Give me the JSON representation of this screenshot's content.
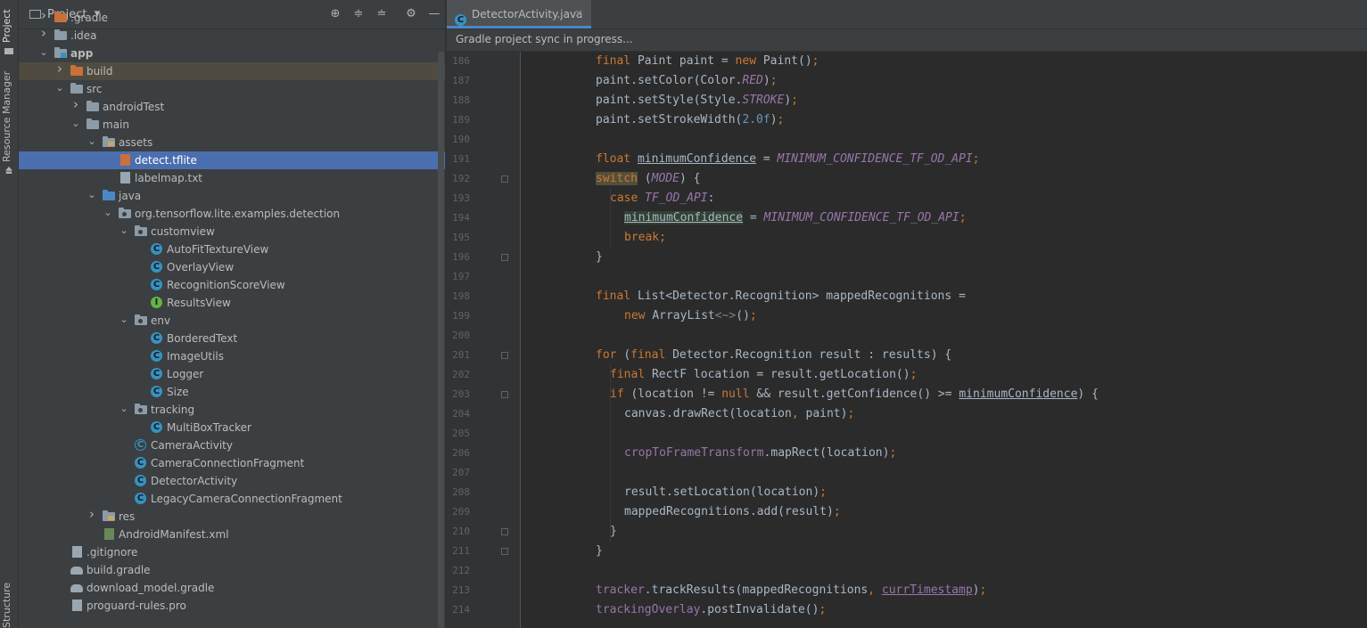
{
  "toolstrip": {
    "tabs": [
      "Project",
      "Resource Manager",
      "Structure"
    ]
  },
  "project_panel": {
    "title": "Project",
    "tree": [
      {
        "label": ".gradle",
        "depth": 1,
        "arrow": "right",
        "icon": "folder-orange"
      },
      {
        "label": ".idea",
        "depth": 1,
        "arrow": "right",
        "icon": "folder"
      },
      {
        "label": "app",
        "depth": 1,
        "arrow": "down",
        "icon": "module-folder",
        "bold": true
      },
      {
        "label": "build",
        "depth": 2,
        "arrow": "right",
        "icon": "folder-orange",
        "excluded": true
      },
      {
        "label": "src",
        "depth": 2,
        "arrow": "down",
        "icon": "folder"
      },
      {
        "label": "androidTest",
        "depth": 3,
        "arrow": "right",
        "icon": "folder"
      },
      {
        "label": "main",
        "depth": 3,
        "arrow": "down",
        "icon": "folder"
      },
      {
        "label": "assets",
        "depth": 4,
        "arrow": "down",
        "icon": "resource-folder"
      },
      {
        "label": "detect.tflite",
        "depth": 5,
        "arrow": "",
        "icon": "tflite-file",
        "selected": true
      },
      {
        "label": "labelmap.txt",
        "depth": 5,
        "arrow": "",
        "icon": "text-file"
      },
      {
        "label": "java",
        "depth": 4,
        "arrow": "down",
        "icon": "source-folder"
      },
      {
        "label": "org.tensorflow.lite.examples.detection",
        "depth": 5,
        "arrow": "down",
        "icon": "package"
      },
      {
        "label": "customview",
        "depth": 6,
        "arrow": "down",
        "icon": "package"
      },
      {
        "label": "AutoFitTextureView",
        "depth": 7,
        "arrow": "",
        "icon": "class"
      },
      {
        "label": "OverlayView",
        "depth": 7,
        "arrow": "",
        "icon": "class"
      },
      {
        "label": "RecognitionScoreView",
        "depth": 7,
        "arrow": "",
        "icon": "class"
      },
      {
        "label": "ResultsView",
        "depth": 7,
        "arrow": "",
        "icon": "interface"
      },
      {
        "label": "env",
        "depth": 6,
        "arrow": "down",
        "icon": "package"
      },
      {
        "label": "BorderedText",
        "depth": 7,
        "arrow": "",
        "icon": "class"
      },
      {
        "label": "ImageUtils",
        "depth": 7,
        "arrow": "",
        "icon": "class"
      },
      {
        "label": "Logger",
        "depth": 7,
        "arrow": "",
        "icon": "class"
      },
      {
        "label": "Size",
        "depth": 7,
        "arrow": "",
        "icon": "class"
      },
      {
        "label": "tracking",
        "depth": 6,
        "arrow": "down",
        "icon": "package"
      },
      {
        "label": "MultiBoxTracker",
        "depth": 7,
        "arrow": "",
        "icon": "class"
      },
      {
        "label": "CameraActivity",
        "depth": 6,
        "arrow": "",
        "icon": "abstract-class"
      },
      {
        "label": "CameraConnectionFragment",
        "depth": 6,
        "arrow": "",
        "icon": "class"
      },
      {
        "label": "DetectorActivity",
        "depth": 6,
        "arrow": "",
        "icon": "class"
      },
      {
        "label": "LegacyCameraConnectionFragment",
        "depth": 6,
        "arrow": "",
        "icon": "class"
      },
      {
        "label": "res",
        "depth": 4,
        "arrow": "right",
        "icon": "resource-folder"
      },
      {
        "label": "AndroidManifest.xml",
        "depth": 4,
        "arrow": "",
        "icon": "xml-file"
      },
      {
        "label": ".gitignore",
        "depth": 2,
        "arrow": "",
        "icon": "text-file"
      },
      {
        "label": "build.gradle",
        "depth": 2,
        "arrow": "",
        "icon": "gradle-file"
      },
      {
        "label": "download_model.gradle",
        "depth": 2,
        "arrow": "",
        "icon": "gradle-file"
      },
      {
        "label": "proguard-rules.pro",
        "depth": 2,
        "arrow": "",
        "icon": "text-file"
      }
    ]
  },
  "editor": {
    "tab_label": "DetectorActivity.java",
    "banner": "Gradle project sync in progress...",
    "lines": [
      {
        "n": "186",
        "indent": 0,
        "html": "<span class='kw'>final </span>Paint paint = <span class='kw'>new </span>Paint()<span class='kw'>;</span>"
      },
      {
        "n": "187",
        "indent": 0,
        "html": "paint.setColor(Color.<span class='cst'>RED</span>)<span class='kw'>;</span>"
      },
      {
        "n": "188",
        "indent": 0,
        "html": "paint.setStyle(Style.<span class='cst'>STROKE</span>)<span class='kw'>;</span>"
      },
      {
        "n": "189",
        "indent": 0,
        "html": "paint.setStrokeWidth(<span class='num'>2.0f</span>)<span class='kw'>;</span>"
      },
      {
        "n": "190",
        "indent": 0,
        "html": ""
      },
      {
        "n": "191",
        "indent": 0,
        "html": "<span class='kw'>float </span><span class='ul'>minimumConfidence</span> = <span class='cst'>MINIMUM_CONFIDENCE_TF_OD_API</span><span class='kw'>;</span>"
      },
      {
        "n": "192",
        "indent": 0,
        "html": "<span class='kw hl-bg'>switch</span> (<span class='cst'>MODE</span>) {",
        "fold": true
      },
      {
        "n": "193",
        "indent": 1,
        "html": "<span class='kw'>case </span><span class='cst'>TF_OD_API</span>:"
      },
      {
        "n": "194",
        "indent": 2,
        "html": "<span class='ul hl-read'>minimumConfidence</span> = <span class='cst'>MINIMUM_CONFIDENCE_TF_OD_API</span><span class='kw'>;</span>"
      },
      {
        "n": "195",
        "indent": 2,
        "html": "<span class='kw'>break;</span>"
      },
      {
        "n": "196",
        "indent": 0,
        "html": "}",
        "fold": true
      },
      {
        "n": "197",
        "indent": 0,
        "html": ""
      },
      {
        "n": "198",
        "indent": 0,
        "html": "<span class='kw'>final </span>List&lt;Detector.Recognition&gt; mappedRecognitions ="
      },
      {
        "n": "199",
        "indent": 2,
        "html": "<span class='kw'>new </span>ArrayList<span class='hint'>&lt;~&gt;</span>()<span class='kw'>;</span>"
      },
      {
        "n": "200",
        "indent": 0,
        "html": ""
      },
      {
        "n": "201",
        "indent": 0,
        "html": "<span class='kw'>for </span>(<span class='kw'>final </span>Detector.Recognition result : results) {",
        "fold": true
      },
      {
        "n": "202",
        "indent": 1,
        "html": "<span class='kw'>final </span>RectF location = result.getLocation()<span class='kw'>;</span>"
      },
      {
        "n": "203",
        "indent": 1,
        "html": "<span class='kw'>if </span>(location != <span class='kw'>null </span>&amp;&amp; result.getConfidence() &gt;= <span class='ul'>minimumConfidence</span>) {",
        "fold": true
      },
      {
        "n": "204",
        "indent": 2,
        "html": "canvas.drawRect(location<span class='kw'>, </span>paint)<span class='kw'>;</span>"
      },
      {
        "n": "205",
        "indent": 0,
        "html": ""
      },
      {
        "n": "206",
        "indent": 2,
        "html": "<span class='fld'>cropToFrameTransform</span>.mapRect(location)<span class='kw'>;</span>"
      },
      {
        "n": "207",
        "indent": 0,
        "html": ""
      },
      {
        "n": "208",
        "indent": 2,
        "html": "result.setLocation(location)<span class='kw'>;</span>"
      },
      {
        "n": "209",
        "indent": 2,
        "html": "mappedRecognitions.add(result)<span class='kw'>;</span>"
      },
      {
        "n": "210",
        "indent": 1,
        "html": "}",
        "fold": true
      },
      {
        "n": "211",
        "indent": 0,
        "html": "}",
        "fold": true
      },
      {
        "n": "212",
        "indent": 0,
        "html": ""
      },
      {
        "n": "213",
        "indent": 0,
        "html": "<span class='fld'>tracker</span>.trackResults(mappedRecognitions<span class='kw'>, </span><span class='fld ul'>currTimestamp</span>)<span class='kw'>;</span>"
      },
      {
        "n": "214",
        "indent": 0,
        "html": "<span class='fld'>trackingOverlay</span>.postInvalidate()<span class='kw'>;</span>"
      }
    ]
  },
  "colors": {
    "accent": "#4a88c7",
    "selection": "#4b6eaf",
    "keyword": "#cc7832",
    "constant": "#9876aa",
    "number": "#6897bb"
  }
}
